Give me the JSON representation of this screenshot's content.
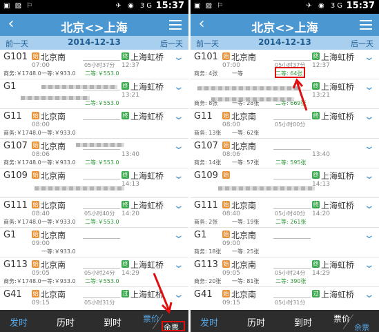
{
  "status_bar": {
    "left_icons": "▣ ▨ ⚐",
    "right_icons": "✈ ◉ 3G",
    "time": "15:37"
  },
  "title_bar": {
    "back_icon": "chevron-left-icon",
    "title": "北京<>上海",
    "menu_icon": "menu-icon"
  },
  "date_bar": {
    "prev": "前一天",
    "date": "2014-12-13",
    "next": "后一天"
  },
  "left_panel": {
    "trains": [
      {
        "no": "G101",
        "start_badge": "始",
        "dep": "北京南",
        "dep_time": "07:00",
        "end_badge": "终",
        "arr": "上海虹桥",
        "arr_time": "12:37",
        "duration": "05小时37分",
        "biz": "商务:￥1748.0",
        "first": "一等:￥933.0",
        "second": "二等:￥553.0"
      },
      {
        "no": "G1",
        "start_badge": "",
        "dep": "",
        "dep_time": "",
        "end_badge": "终",
        "arr": "上海虹桥",
        "arr_time": "13:21",
        "duration": "",
        "biz": "",
        "first": "",
        "second": "二等:￥553.0"
      },
      {
        "no": "G11",
        "start_badge": "始",
        "dep": "北京南",
        "dep_time": "08:00",
        "end_badge": "终",
        "arr": "上海虹桥",
        "arr_time": "",
        "duration": "",
        "biz": "商务:￥1748.0",
        "first": "一等:￥933.0",
        "second": ""
      },
      {
        "no": "G107",
        "start_badge": "始",
        "dep": "北京南",
        "dep_time": "08:06",
        "end_badge": "",
        "arr": "",
        "arr_time": "13:40",
        "duration": "",
        "biz": "商务:￥1748.0",
        "first": "一等:￥933.0",
        "second": "二等:￥553.0"
      },
      {
        "no": "G109",
        "start_badge": "始",
        "dep": "北京南",
        "dep_time": "",
        "end_badge": "终",
        "arr": "上海虹桥",
        "arr_time": "14:13",
        "duration": "",
        "biz": "",
        "first": "",
        "second": ""
      },
      {
        "no": "G111",
        "start_badge": "始",
        "dep": "北京南",
        "dep_time": "08:40",
        "end_badge": "终",
        "arr": "上海虹桥",
        "arr_time": "14:20",
        "duration": "05小时40分",
        "biz": "商务:￥1748.0",
        "first": "一等:￥933.0",
        "second": "二等:￥553.0"
      },
      {
        "no": "G1",
        "start_badge": "始",
        "dep": "北京南",
        "dep_time": "09:00",
        "end_badge": "",
        "arr": "",
        "arr_time": "",
        "duration": "",
        "biz": "",
        "first": "一等:￥933.0",
        "second": ""
      },
      {
        "no": "G113",
        "start_badge": "始",
        "dep": "北京南",
        "dep_time": "09:05",
        "end_badge": "终",
        "arr": "上海虹桥",
        "arr_time": "14:29",
        "duration": "05小时24分",
        "biz": "商务:￥1748.0",
        "first": "一等:￥933.0",
        "second": "二等:￥553.0"
      },
      {
        "no": "G41",
        "start_badge": "始",
        "dep": "北京南",
        "dep_time": "09:15",
        "end_badge": "过",
        "arr": "上海虹桥",
        "arr_time": "",
        "duration": "05小时31分",
        "biz": "",
        "first": "",
        "second": ""
      }
    ],
    "bottom": {
      "sort_dep": "发时",
      "sort_dur": "历时",
      "sort_arr": "到时",
      "sort_price": "票价",
      "sort_remain": "余票"
    }
  },
  "right_panel": {
    "trains": [
      {
        "no": "G101",
        "start_badge": "始",
        "dep": "北京南",
        "dep_time": "07:00",
        "end_badge": "终",
        "arr": "上海虹桥",
        "arr_time": "12:37",
        "duration": "05小时37分",
        "biz": "商务: 4张",
        "first": "一等",
        "second": "二等: 64张"
      },
      {
        "no": "",
        "start_badge": "",
        "dep": "",
        "dep_time": "",
        "end_badge": "终",
        "arr": "上海虹桥",
        "arr_time": "13:21",
        "duration": "",
        "biz": "商务: 8张",
        "first": "一等: 28张",
        "second": "二等: 669张"
      },
      {
        "no": "G11",
        "start_badge": "始",
        "dep": "北京南",
        "dep_time": "08:00",
        "end_badge": "终",
        "arr": "上海虹桥",
        "arr_time": "",
        "duration": "05小时00分",
        "biz": "商务: 13张",
        "first": "一等: 62张",
        "second": ""
      },
      {
        "no": "G107",
        "start_badge": "始",
        "dep": "北京南",
        "dep_time": "08:06",
        "end_badge": "",
        "arr": "",
        "arr_time": "13:40",
        "duration": "",
        "biz": "商务: 14张",
        "first": "一等: 57张",
        "second": "二等: 595张"
      },
      {
        "no": "G109",
        "start_badge": "始",
        "dep": "",
        "dep_time": "",
        "end_badge": "终",
        "arr": "上海虹桥",
        "arr_time": "14:13",
        "duration": "",
        "biz": "",
        "first": "",
        "second": ""
      },
      {
        "no": "G111",
        "start_badge": "始",
        "dep": "北京南",
        "dep_time": "08:40",
        "end_badge": "终",
        "arr": "上海虹桥",
        "arr_time": "14:20",
        "duration": "05小时40分",
        "biz": "商务: 2张",
        "first": "一等: 19张",
        "second": "二等: 261张"
      },
      {
        "no": "G1",
        "start_badge": "始",
        "dep": "北京南",
        "dep_time": "09:00",
        "end_badge": "",
        "arr": "",
        "arr_time": "",
        "duration": "",
        "biz": "商务: 18张",
        "first": "一等: 25张",
        "second": ""
      },
      {
        "no": "G113",
        "start_badge": "始",
        "dep": "北京南",
        "dep_time": "09:05",
        "end_badge": "终",
        "arr": "上海虹桥",
        "arr_time": "14:29",
        "duration": "05小时24分",
        "biz": "商务: 20张",
        "first": "一等: 81张",
        "second": "二等: 390张"
      },
      {
        "no": "G41",
        "start_badge": "始",
        "dep": "北京南",
        "dep_time": "09:15",
        "end_badge": "过",
        "arr": "上海虹桥",
        "arr_time": "",
        "duration": "05小时31分",
        "biz": "",
        "first": "",
        "second": ""
      }
    ],
    "bottom": {
      "sort_dep": "发时",
      "sort_dur": "历时",
      "sort_arr": "到时",
      "sort_price": "票价",
      "sort_remain": "余票"
    }
  },
  "colors": {
    "title_bar": "#4b97d2",
    "date_bar": "#a9cfee",
    "bottom_bar": "#2d2d2d",
    "annotation": "#e01010"
  }
}
